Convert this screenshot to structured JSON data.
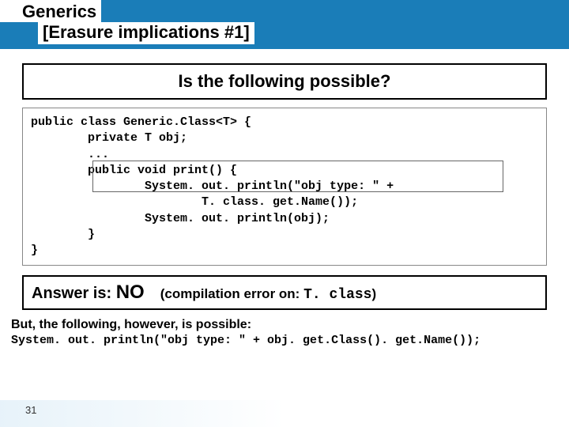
{
  "header": {
    "line1": "Generics",
    "line2": "[Erasure implications #1]"
  },
  "question": "Is the following possible?",
  "code": "public class Generic.Class<T> {\n        private T obj;\n        ...\n        public void print() {\n                System. out. println(\"obj type: \" +\n                        T. class. get.Name());\n                System. out. println(obj);\n        }\n}",
  "answer": {
    "lead": "Answer is: ",
    "verdict": "NO",
    "explain_prefix": "(compilation error on: ",
    "explain_code": "T. class",
    "explain_suffix": ")"
  },
  "followup": {
    "text": "But, the following, however, is possible:",
    "code": "System. out. println(\"obj type: \" + obj. get.Class(). get.Name());"
  },
  "page": "31"
}
